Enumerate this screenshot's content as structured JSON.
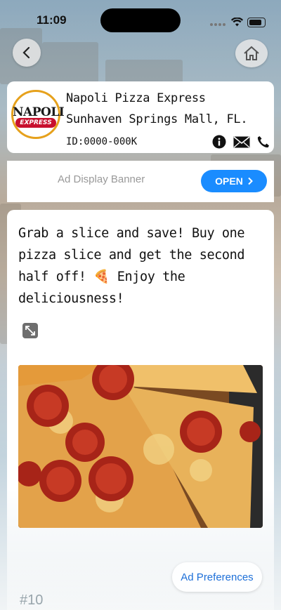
{
  "status_bar": {
    "time": "11:09"
  },
  "business": {
    "logo_word": "NAPOLI",
    "logo_banner": "EXPRESS",
    "name": "Napoli Pizza Express",
    "location": "Sunhaven Springs Mall, FL.",
    "id": "ID:0000-000K"
  },
  "ad_banner": {
    "text": "Ad Display Banner",
    "open_label": "OPEN"
  },
  "promo": {
    "text": "Grab a slice and save! Buy one pizza slice and get the second half off! 🍕 Enjoy the deliciousness!"
  },
  "footer": {
    "ad_preferences_label": "Ad Preferences",
    "tag": "#10"
  },
  "colors": {
    "accent": "#1a8cff",
    "link": "#1d6fd8",
    "logo_red": "#c8102e"
  }
}
